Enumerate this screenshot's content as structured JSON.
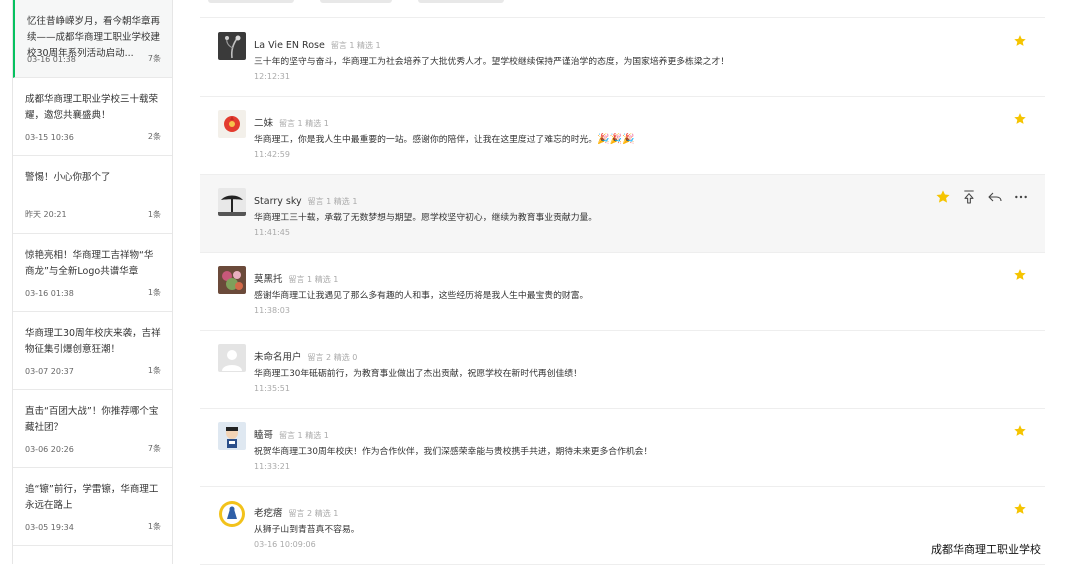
{
  "articles": [
    {
      "title": "忆往昔峥嵘岁月，看今朝华章再续——成都华商理工职业学校建校30周年系列活动启动...",
      "date": "03-16 01:38",
      "count": "7条"
    },
    {
      "title": "成都华商理工职业学校三十载荣耀，邀您共襄盛典！",
      "date": "03-15 10:36",
      "count": "2条"
    },
    {
      "title": "警惕！小心你那个了",
      "date": "昨天 20:21",
      "count": "1条"
    },
    {
      "title": "惊艳亮相！华商理工吉祥物“华商龙”与全新Logo共谱华章",
      "date": "03-16 01:38",
      "count": "1条"
    },
    {
      "title": "华商理工30周年校庆来袭，吉祥物征集引爆创意狂潮！",
      "date": "03-07 20:37",
      "count": "1条"
    },
    {
      "title": "直击“百团大战”！你推荐哪个宝藏社团？",
      "date": "03-06 20:26",
      "count": "7条"
    },
    {
      "title": "追“镲”前行，学雷镲，华商理工永远在路上",
      "date": "03-05 19:34",
      "count": "1条"
    }
  ],
  "comments": [
    {
      "name": "La Vie EN Rose",
      "meta": "留言 1  精选 1",
      "text": "三十年的坚守与奋斗，华商理工为社会培养了大批优秀人才。望学校继续保持严谨治学的态度，为国家培养更多栋梁之才！",
      "time": "12:12:31",
      "avatar": "plant"
    },
    {
      "name": "二妹",
      "meta": "留言 1  精选 1",
      "text": "华商理工，你是我人生中最重要的一站。感谢你的陪伴，让我在这里度过了难忘的时光。",
      "party": "🎉🎉🎉",
      "time": "11:42:59",
      "avatar": "flower"
    },
    {
      "name": "Starry sky",
      "meta": "留言 1  精选 1",
      "text": "华商理工三十载，承载了无数梦想与期望。愿学校坚守初心，继续为教育事业贡献力量。",
      "time": "11:41:45",
      "avatar": "tree"
    },
    {
      "name": "莫黑托",
      "meta": "留言 1  精选 1",
      "text": "感谢华商理工让我遇见了那么多有趣的人和事，这些经历将是我人生中最宝贵的财富。",
      "time": "11:38:03",
      "avatar": "flowers"
    },
    {
      "name": "未命名用户",
      "meta": "留言 2  精选 0",
      "text": "华商理工30年砥砺前行，为教育事业做出了杰出贡献，祝愿学校在新时代再创佳绩！",
      "time": "11:35:51",
      "avatar": "default"
    },
    {
      "name": "瞌哥",
      "meta": "留言 1  精选 1",
      "text": "祝贺华商理工30周年校庆！作为合作伙伴，我们深感荣幸能与贵校携手共进，期待未来更多合作机会！",
      "time": "11:33:21",
      "avatar": "cartoon"
    },
    {
      "name": "老疙瘩",
      "meta": "留言 2  精选 1",
      "text": "从狮子山到青苔真不容易。",
      "time": "03-16 10:09:06",
      "avatar": "badge"
    }
  ],
  "colors": {
    "star": "#f5c400",
    "accent": "#07c160"
  },
  "watermark": "成都华商理工职业学校"
}
